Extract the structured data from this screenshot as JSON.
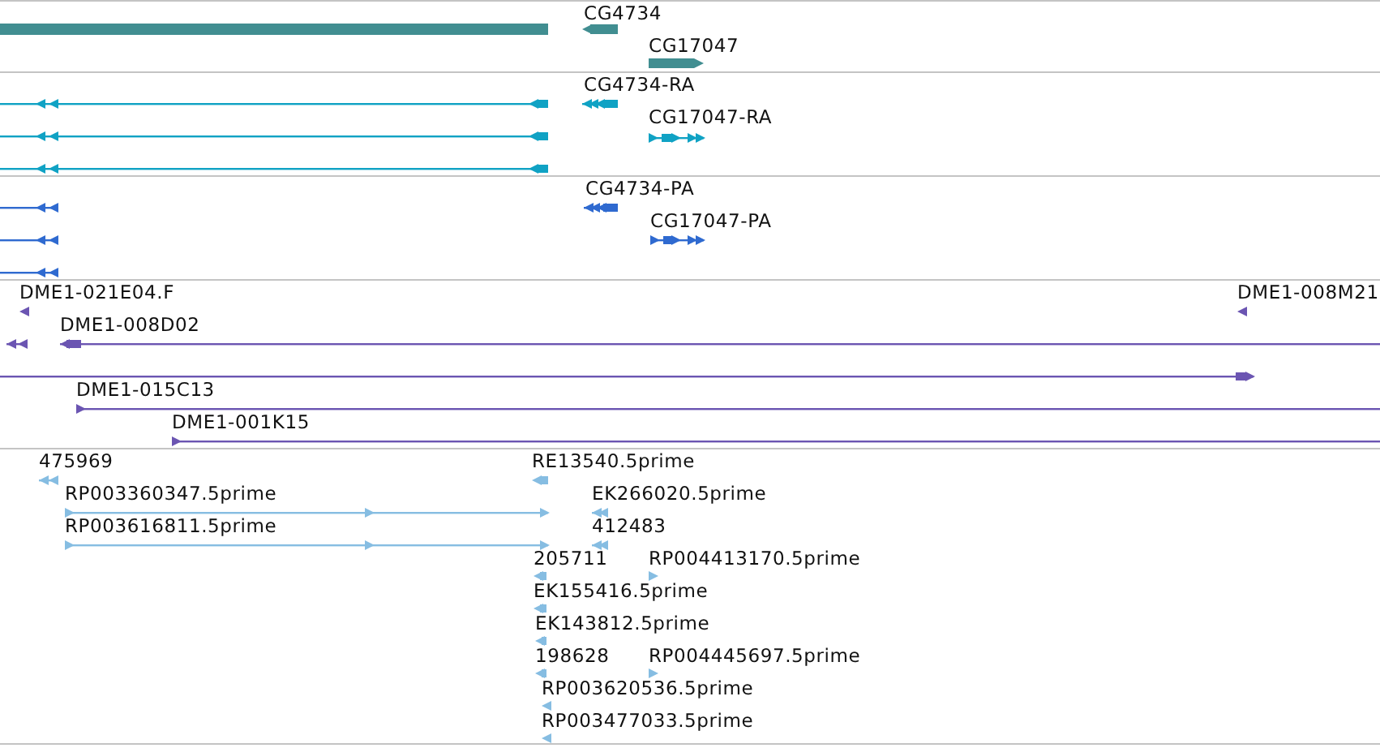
{
  "tracks": [
    {
      "color": "#418e91",
      "features": [
        {
          "reverse": true
        },
        {
          "label": "CG4734",
          "reverse": true
        },
        {
          "label": "CG17047",
          "reverse": false
        }
      ]
    },
    {
      "color": "#10a2c4",
      "features": [
        {
          "reverse": true
        },
        {
          "reverse": true
        },
        {
          "reverse": true
        },
        {
          "label": "CG4734-RA",
          "reverse": true
        },
        {
          "label": "CG17047-RA",
          "reverse": false
        }
      ]
    },
    {
      "color": "#2f6ad0",
      "features": [
        {
          "reverse": true
        },
        {
          "reverse": true
        },
        {
          "reverse": true
        },
        {
          "label": "CG4734-PA",
          "reverse": true
        },
        {
          "label": "CG17047-PA",
          "reverse": false
        }
      ]
    },
    {
      "color": "#6b55b2",
      "features": [
        {
          "label": "DME1-021E04.F",
          "reverse": true
        },
        {
          "label": "DME1-008M21",
          "reverse": true
        },
        {
          "reverse": true
        },
        {
          "label": "DME1-008D02",
          "reverse": true
        },
        {
          "reverse": false
        },
        {
          "label": "DME1-015C13",
          "reverse": false
        },
        {
          "label": "DME1-001K15",
          "reverse": false
        }
      ]
    },
    {
      "color": "#86bde2",
      "features": [
        {
          "label": "475969",
          "reverse": true
        },
        {
          "label": "RP003360347.5prime",
          "reverse": false
        },
        {
          "label": "RP003616811.5prime",
          "reverse": false
        },
        {
          "label": "RE13540.5prime",
          "reverse": true
        },
        {
          "label": "EK266020.5prime",
          "reverse": true
        },
        {
          "label": "412483",
          "reverse": true
        },
        {
          "label": "205711",
          "reverse": true
        },
        {
          "label": "RP004413170.5prime",
          "reverse": false
        },
        {
          "label": "EK155416.5prime",
          "reverse": true
        },
        {
          "label": "EK143812.5prime",
          "reverse": true
        },
        {
          "label": "198628",
          "reverse": true
        },
        {
          "label": "RP004445697.5prime",
          "reverse": false
        },
        {
          "label": "RP003620536.5prime",
          "reverse": true
        },
        {
          "label": "RP003477033.5prime",
          "reverse": true
        }
      ]
    }
  ]
}
